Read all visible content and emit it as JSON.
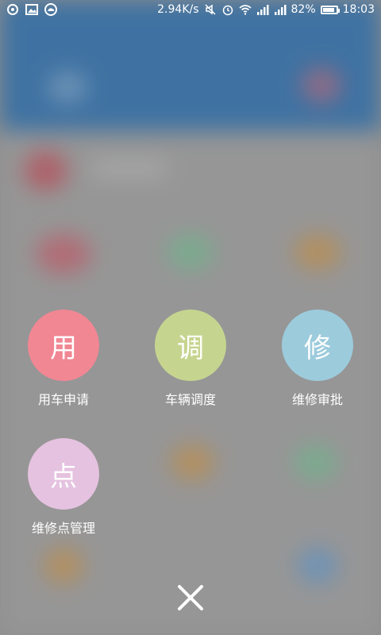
{
  "status_bar": {
    "network_speed": "2.94K/s",
    "battery_text": "82%",
    "battery_level": 0.82,
    "time": "18:03",
    "icons": [
      "sync-icon",
      "image-icon",
      "cloud-icon",
      "mute-icon",
      "alarm-icon",
      "wifi-icon",
      "signal-icon",
      "signal-icon",
      "battery-icon"
    ]
  },
  "menu": {
    "items": [
      {
        "glyph": "用",
        "label": "用车申请",
        "color": "#f08793"
      },
      {
        "glyph": "调",
        "label": "车辆调度",
        "color": "#c5d58f"
      },
      {
        "glyph": "修",
        "label": "维修审批",
        "color": "#9ccbdc"
      },
      {
        "glyph": "点",
        "label": "维修点管理",
        "color": "#e5c2e0"
      }
    ]
  },
  "close_icon": "close-icon"
}
